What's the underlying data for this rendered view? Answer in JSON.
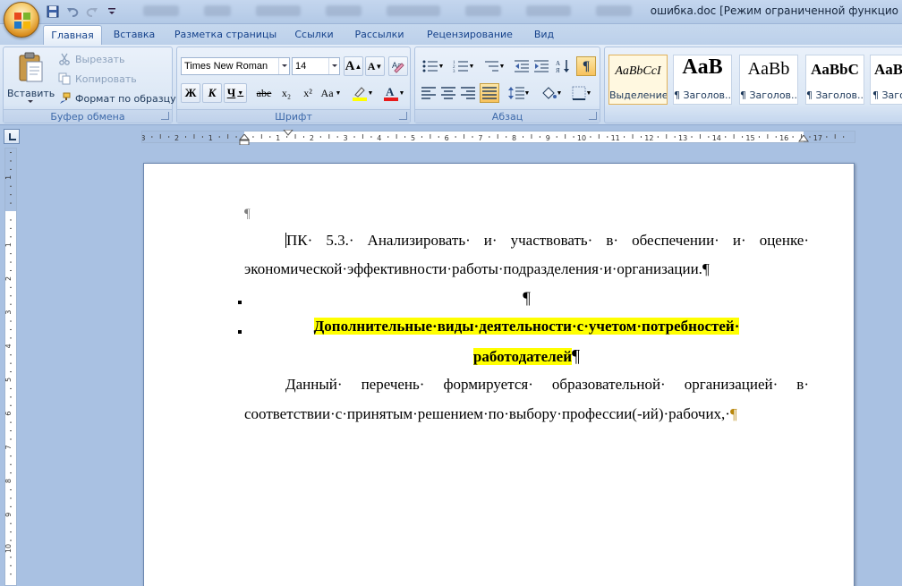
{
  "window": {
    "title": "ошибка.doc [Режим ограниченной функцио"
  },
  "tabs": [
    "Главная",
    "Вставка",
    "Разметка страницы",
    "Ссылки",
    "Рассылки",
    "Рецензирование",
    "Вид"
  ],
  "ribbon": {
    "clipboard": {
      "label": "Буфер обмена",
      "paste": "Вставить",
      "cut": "Вырезать",
      "copy": "Копировать",
      "format_painter": "Формат по образцу"
    },
    "font": {
      "label": "Шрифт",
      "font_name": "Times New Roman",
      "font_size": "14",
      "bold": "Ж",
      "italic": "К",
      "underline": "Ч",
      "strike": "abe",
      "subscript": "x₂",
      "superscript": "x²",
      "change_case": "Aa",
      "grow": "A",
      "shrink": "A"
    },
    "paragraph": {
      "label": "Абзац",
      "show_marks": "¶"
    },
    "styles": [
      {
        "sample": "AaBbCcI",
        "name": "Выделение"
      },
      {
        "sample": "AaB",
        "name": "¶ Заголов..."
      },
      {
        "sample": "AaBb",
        "name": "¶ Заголов..."
      },
      {
        "sample": "AaBbC",
        "name": "¶ Заголов..."
      },
      {
        "sample": "AaBb",
        "name": "¶ Загол"
      }
    ]
  },
  "ruler": {
    "h_ticks": [
      "3",
      "2",
      "1",
      "1",
      "2",
      "3",
      "4",
      "5",
      "6",
      "7",
      "8",
      "9",
      "10",
      "11",
      "12",
      "13",
      "14",
      "15",
      "16",
      "17"
    ],
    "v_ticks": [
      "2",
      "1",
      "1",
      "2",
      "3",
      "4",
      "5",
      "6",
      "7",
      "8",
      "9",
      "10"
    ]
  },
  "document": {
    "empty_mark": "¶",
    "p1_line1": "ПК· 5.3.· Анализировать· и· участвовать· в· обеспечении· и· оценке·",
    "p1_line2": "экономической·эффективности·работы·подразделения·и·организации.",
    "p1_mark": "¶",
    "center_mark": "¶",
    "heading_line1": "Дополнительные·виды·деятельности·с·учетом·потребностей·",
    "heading_line2": "работодателей",
    "heading_mark": "¶",
    "p2_line1": "Данный· перечень· формируется· образовательной· организацией· в·",
    "p2_line2": "соответствии·с·принятым·решением·по·выбору·профессии(-ий)·рабочих,·",
    "p2_mark": "¶"
  }
}
